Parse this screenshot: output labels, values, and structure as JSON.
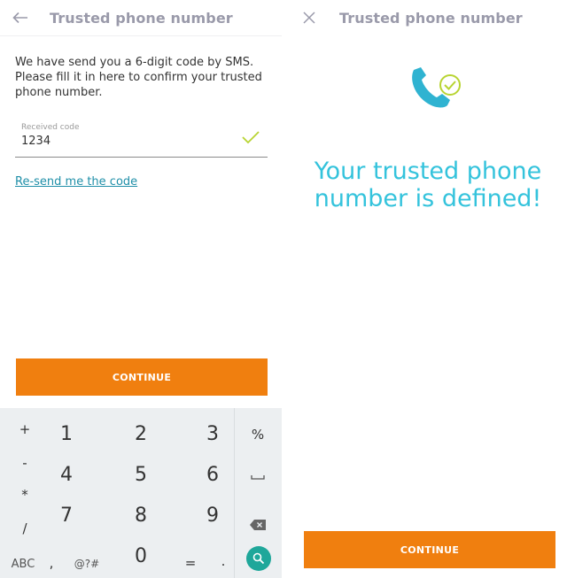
{
  "left_screen": {
    "appbar": {
      "title": "Trusted phone number",
      "nav_icon": "back-arrow-icon"
    },
    "instructions": "We have send you a 6-digit code by SMS. Please fill it in here to confirm your trusted phone number.",
    "code_field": {
      "label": "Received code",
      "value": "1234",
      "status_icon": "check-icon"
    },
    "resend_link": "Re-send me the code",
    "continue_button": "CONTINUE",
    "keyboard": {
      "left_symbols": [
        "+",
        "-",
        "*",
        "/"
      ],
      "digits": [
        "1",
        "2",
        "3",
        "4",
        "5",
        "6",
        "7",
        "8",
        "9",
        "0"
      ],
      "right_symbols": [
        "%",
        "space-icon",
        "backspace-icon",
        "search-icon"
      ],
      "bottom_row": {
        "abc": "ABC",
        "comma": ",",
        "symbols": "@?#",
        "equals": "=",
        "period": "."
      }
    }
  },
  "right_screen": {
    "appbar": {
      "title": "Trusted phone number",
      "nav_icon": "close-icon"
    },
    "illustration": "phone-check-icon",
    "success_message": "Your trusted phone number is defined!",
    "continue_button": "CONTINUE"
  },
  "colors": {
    "accent_orange": "#f07f0f",
    "teal_text": "#34c3dc",
    "link": "#1f8fa8",
    "check_green": "#b8d432",
    "keyboard_bg": "#eceff1",
    "search_key": "#1fa79a"
  }
}
